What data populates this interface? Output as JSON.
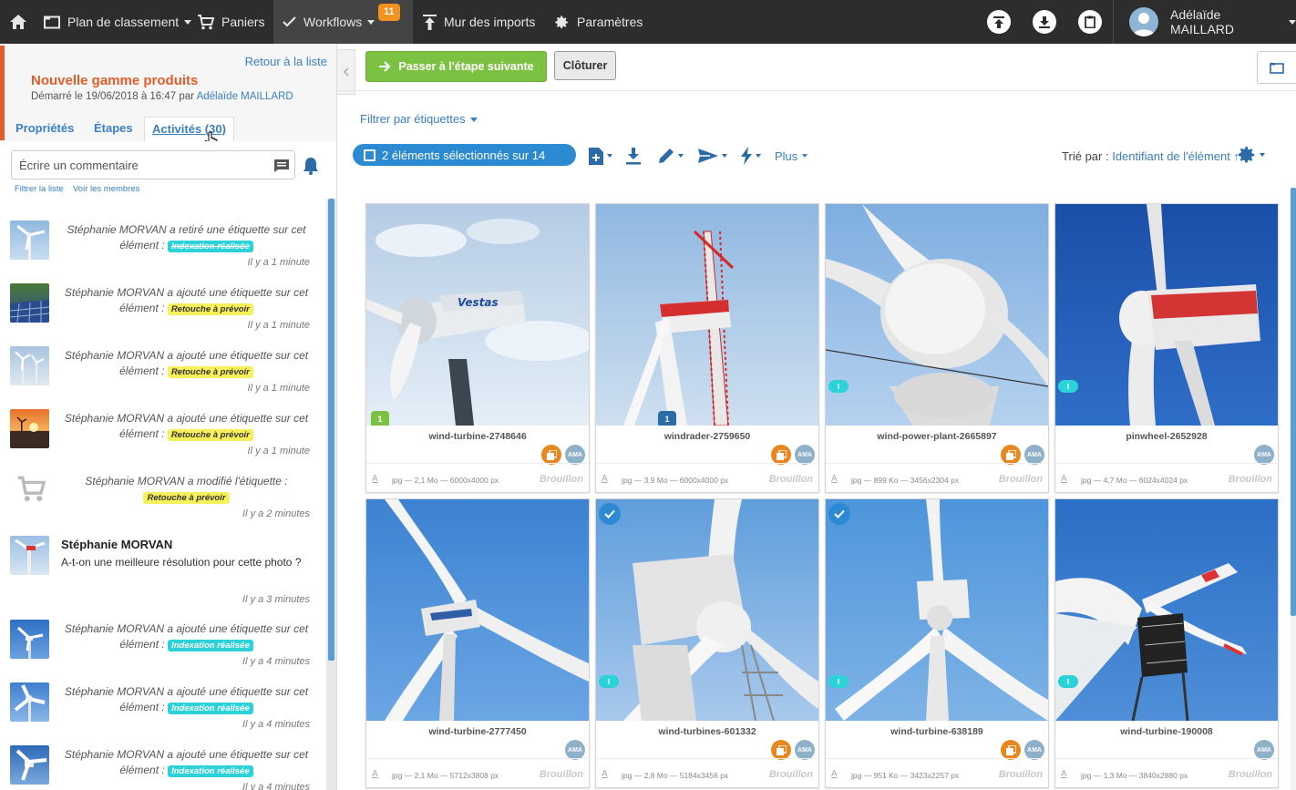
{
  "topbar": {
    "home_icon": "home-icon",
    "plan": "Plan de classement",
    "paniers": "Paniers",
    "workflows": "Workflows",
    "workflows_badge": "11",
    "mur": "Mur des imports",
    "parametres": "Paramètres",
    "user": "Adélaïde MAILLARD"
  },
  "sidebar": {
    "back_link": "Retour à la liste",
    "workflow_title": "Nouvelle gamme produits",
    "started_prefix": "Démarré le 19/06/2018 à 16:47 par",
    "started_by": "Adélaïde MAILLARD",
    "tabs": [
      "Propriétés",
      "Étapes",
      "Activités (30)"
    ],
    "comment_placeholder": "Écrire un commentaire",
    "filter_link": "Filtrer la liste",
    "members_link": "Voir les membres"
  },
  "activities": [
    {
      "text": "Stéphanie MORVAN a retiré une étiquette sur cet élément :",
      "tag": "Indexation réalisée",
      "tag_style": "cyan-strike",
      "time": "Il y a 1 minute"
    },
    {
      "text": "Stéphanie MORVAN a ajouté une étiquette sur cet élément :",
      "tag": "Retouche à prévoir",
      "tag_style": "yellow",
      "time": "Il y a 1 minute"
    },
    {
      "text": "Stéphanie MORVAN a ajouté une étiquette sur cet élément :",
      "tag": "Retouche à prévoir",
      "tag_style": "yellow",
      "time": "Il y a 1 minute"
    },
    {
      "text": "Stéphanie MORVAN a ajouté une étiquette sur cet élément :",
      "tag": "Retouche à prévoir",
      "tag_style": "yellow",
      "time": "Il y a 1 minute"
    },
    {
      "text": "Stéphanie MORVAN a modifié l'étiquette :",
      "tag": "Retouche à prévoir",
      "tag_style": "yellow",
      "time": "Il y a 2 minutes"
    },
    {
      "author": "Stéphanie MORVAN",
      "comment": "A-t-on une meilleure résolution pour cette photo ?",
      "time": "Il y a 3 minutes"
    },
    {
      "text": "Stéphanie MORVAN a ajouté une étiquette sur cet élément :",
      "tag": "Indexation réalisée",
      "tag_style": "cyan",
      "time": "Il y a 4 minutes"
    },
    {
      "text": "Stéphanie MORVAN a ajouté une étiquette sur cet élément :",
      "tag": "Indexation réalisée",
      "tag_style": "cyan",
      "time": "Il y a 4 minutes"
    },
    {
      "text": "Stéphanie MORVAN a ajouté une étiquette sur cet élément :",
      "tag": "Indexation réalisée",
      "tag_style": "cyan",
      "time": "Il y a 4 minutes"
    }
  ],
  "main": {
    "next_button": "Passer à l'étape suivante",
    "close_button": "Clôturer",
    "filter_tags": "Filtrer par étiquettes",
    "selection": "2 éléments sélectionnés sur 14",
    "more": "Plus",
    "sort_label": "Trié par :",
    "sort_value": "Identifiant de l'élément ↑"
  },
  "cards": [
    {
      "name": "wind-turbine-2748646",
      "meta": "jpg — 2,1 Mo — 6000x4000 px",
      "status": "Brouillon",
      "num": "1",
      "num_color": "#7cc242",
      "orange": true,
      "ama": "AMA",
      "pill": "",
      "checked": false
    },
    {
      "name": "windrader-2759650",
      "meta": "jpg — 3,9 Mo — 6000x4000 px",
      "status": "Brouillon",
      "num": "1",
      "num_color": "#2b6ca8",
      "orange": true,
      "ama": "AMA",
      "pill": "",
      "checked": false
    },
    {
      "name": "wind-power-plant-2665897",
      "meta": "jpg — 899 Ko — 3456x2304 px",
      "status": "Brouillon",
      "num": "",
      "orange": true,
      "ama": "AMA",
      "pill": "I",
      "checked": false
    },
    {
      "name": "pinwheel-2652928",
      "meta": "jpg — 4,7 Mo — 6024x4024 px",
      "status": "Brouillon",
      "num": "",
      "orange": false,
      "ama": "AMA",
      "pill": "I",
      "checked": false
    },
    {
      "name": "wind-turbine-2777450",
      "meta": "jpg — 2,1 Mo — 5712x3808 px",
      "status": "Brouillon",
      "num": "",
      "orange": false,
      "ama": "AMA",
      "pill": "",
      "checked": false
    },
    {
      "name": "wind-turbines-601332",
      "meta": "jpg — 2,8 Mo — 5184x3456 px",
      "status": "Brouillon",
      "num": "",
      "orange": true,
      "ama": "AMA",
      "pill": "I",
      "checked": true
    },
    {
      "name": "wind-turbine-638189",
      "meta": "jpg — 951 Ko — 3423x2257 px",
      "status": "Brouillon",
      "num": "",
      "orange": true,
      "ama": "AMA",
      "pill": "I",
      "checked": true
    },
    {
      "name": "wind-turbine-190008",
      "meta": "jpg — 1,3 Mo — 3840x2880 px",
      "status": "Brouillon",
      "num": "",
      "orange": false,
      "ama": "AMA",
      "pill": "I",
      "checked": false
    }
  ]
}
